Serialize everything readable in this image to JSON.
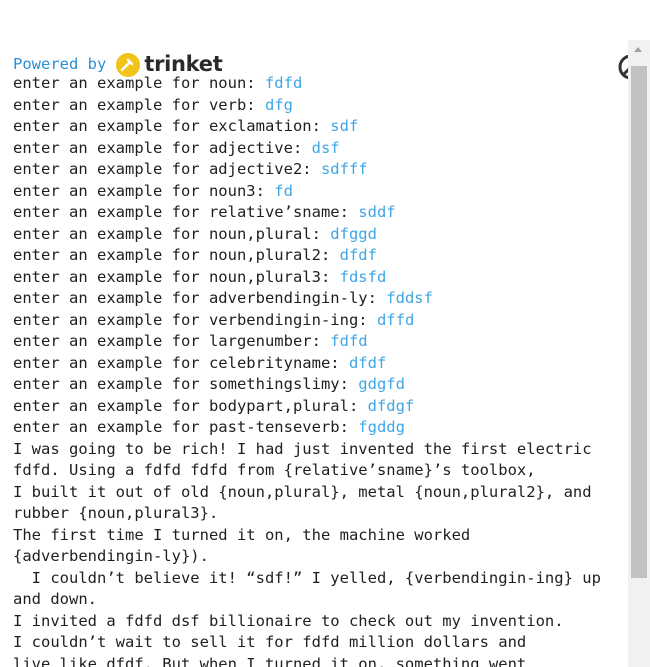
{
  "header": {
    "powered_by": "Powered by",
    "brand": "trinket"
  },
  "prompts": [
    {
      "label": "enter an example for noun: ",
      "value": "fdfd"
    },
    {
      "label": "enter an example for verb: ",
      "value": "dfg"
    },
    {
      "label": "enter an example for exclamation: ",
      "value": "sdf"
    },
    {
      "label": "enter an example for adjective: ",
      "value": "dsf"
    },
    {
      "label": "enter an example for adjective2: ",
      "value": "sdfff"
    },
    {
      "label": "enter an example for noun3: ",
      "value": "fd"
    },
    {
      "label": "enter an example for relative’sname: ",
      "value": "sddf"
    },
    {
      "label": "enter an example for noun,plural: ",
      "value": "dfggd"
    },
    {
      "label": "enter an example for noun,plural2: ",
      "value": "dfdf"
    },
    {
      "label": "enter an example for noun,plural3: ",
      "value": "fdsfd"
    },
    {
      "label": "enter an example for adverbendingin-ly: ",
      "value": "fddsf"
    },
    {
      "label": "enter an example for verbendingin-ing: ",
      "value": "dffd"
    },
    {
      "label": "enter an example for largenumber: ",
      "value": "fdfd"
    },
    {
      "label": "enter an example for celebrityname: ",
      "value": "dfdf"
    },
    {
      "label": "enter an example for somethingslimy: ",
      "value": "gdgfd"
    },
    {
      "label": "enter an example for bodypart,plural: ",
      "value": "dfdgf"
    },
    {
      "label": "enter an example for past-tenseverb: ",
      "value": "fgddg"
    }
  ],
  "story": [
    "I was going to be rich! I had just invented the first electric",
    "fdfd. Using a fdfd fdfd from {relative’sname}’s toolbox,",
    "I built it out of old {noun,plural}, metal {noun,plural2}, and",
    "rubber {noun,plural3}.",
    "The first time I turned it on, the machine worked",
    "{adverbendingin-ly}).",
    "  I couldn’t believe it! “sdf!” I yelled, {verbendingin-ing} up",
    "and down.",
    "I invited a fdfd dsf billionaire to check out my invention.",
    "I couldn’t wait to sell it for fdfd million dollars and",
    "live like dfdf. But when I turned it on, something went"
  ],
  "icons": {
    "stop": "stop-icon",
    "logo": "trinket-logo-icon",
    "scroll_up": "scroll-up-arrow-icon"
  },
  "colors": {
    "accent": "#2a8fd6",
    "input": "#3fa6e6",
    "logo_yellow": "#f2c31b"
  }
}
